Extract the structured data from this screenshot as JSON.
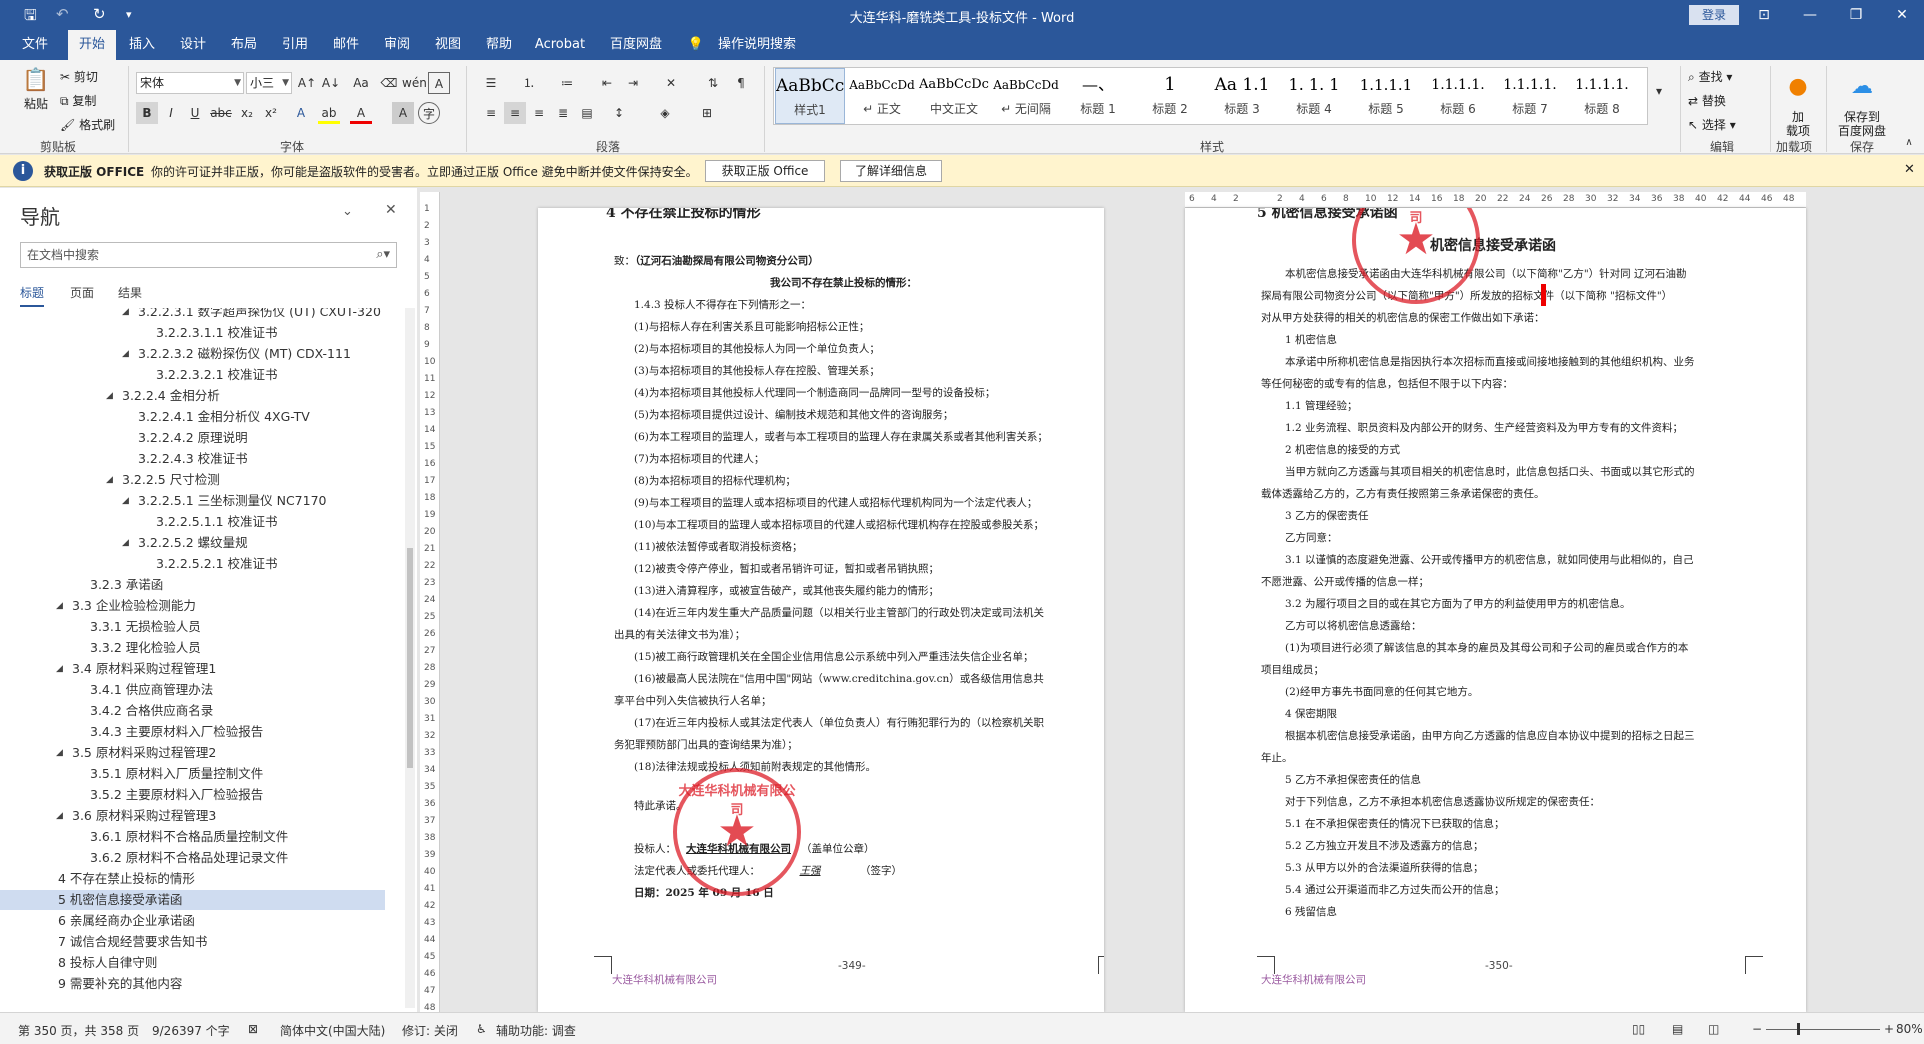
{
  "window": {
    "title": "大连华科-磨铣类工具-投标文件 - Word",
    "login": "登录"
  },
  "tabs": [
    "文件",
    "开始",
    "插入",
    "设计",
    "布局",
    "引用",
    "邮件",
    "审阅",
    "视图",
    "帮助",
    "Acrobat",
    "百度网盘",
    "操作说明搜索"
  ],
  "share": "共享",
  "ribbon": {
    "clipboard": {
      "paste": "粘贴",
      "cut": "剪切",
      "copy": "复制",
      "format_painter": "格式刷",
      "label": "剪贴板"
    },
    "font": {
      "name": "宋体",
      "size": "小三",
      "label": "字体"
    },
    "paragraph": {
      "label": "段落"
    },
    "styles": {
      "label": "样式",
      "items": [
        {
          "preview": "AaBbCc",
          "name": "样式1"
        },
        {
          "preview": "AaBbCcDd",
          "name": "↵ 正文"
        },
        {
          "preview": "AaBbCcDc",
          "name": "中文正文"
        },
        {
          "preview": "AaBbCcDd",
          "name": "↵ 无间隔"
        },
        {
          "preview": "—、",
          "name": "标题 1"
        },
        {
          "preview": "1",
          "name": "标题 2"
        },
        {
          "preview": "Aa 1.1",
          "name": "标题 3"
        },
        {
          "preview": "1. 1. 1",
          "name": "标题 4"
        },
        {
          "preview": "1.1.1.1",
          "name": "标题 5"
        },
        {
          "preview": "1.1.1.1.",
          "name": "标题 6"
        },
        {
          "preview": "1.1.1.1.",
          "name": "标题 7"
        },
        {
          "preview": "1.1.1.1.",
          "name": "标题 8"
        }
      ]
    },
    "editing": {
      "find": "查找",
      "replace": "替换",
      "select": "选择",
      "label": "编辑"
    },
    "addins": {
      "btn": "加\n载项",
      "label": "加载项"
    },
    "save": {
      "btn": "保存到\n百度网盘",
      "label": "保存"
    }
  },
  "message_bar": {
    "title": "获取正版 OFFICE",
    "text": "你的许可证并非正版，你可能是盗版软件的受害者。立即通过正版 Office 避免中断并使文件保持安全。",
    "btn1": "获取正版 Office",
    "btn2": "了解详细信息"
  },
  "nav": {
    "title": "导航",
    "search_placeholder": "在文档中搜索",
    "tabs": [
      "标题",
      "页面",
      "结果"
    ],
    "items": [
      {
        "text": "3.2.2.3.1 数字超声探伤仪 (UT) CXUT-320",
        "level": 5,
        "tri": "expanded"
      },
      {
        "text": "3.2.2.3.1.1 校准证书",
        "level": 6,
        "tri": ""
      },
      {
        "text": "3.2.2.3.2 磁粉探伤仪 (MT) CDX-111",
        "level": 5,
        "tri": "expanded"
      },
      {
        "text": "3.2.2.3.2.1 校准证书",
        "level": 6,
        "tri": ""
      },
      {
        "text": "3.2.2.4 金相分析",
        "level": 4,
        "tri": "expanded"
      },
      {
        "text": "3.2.2.4.1 金相分析仪 4XG-TV",
        "level": 5,
        "tri": ""
      },
      {
        "text": "3.2.2.4.2 原理说明",
        "level": 5,
        "tri": ""
      },
      {
        "text": "3.2.2.4.3 校准证书",
        "level": 5,
        "tri": ""
      },
      {
        "text": "3.2.2.5 尺寸检测",
        "level": 4,
        "tri": "expanded"
      },
      {
        "text": "3.2.2.5.1 三坐标测量仪 NC7170",
        "level": 5,
        "tri": "expanded"
      },
      {
        "text": "3.2.2.5.1.1 校准证书",
        "level": 6,
        "tri": ""
      },
      {
        "text": "3.2.2.5.2 螺纹量规",
        "level": 5,
        "tri": "expanded"
      },
      {
        "text": "3.2.2.5.2.1 校准证书",
        "level": 6,
        "tri": ""
      },
      {
        "text": "3.2.3 承诺函",
        "level": 3,
        "tri": ""
      },
      {
        "text": "3.3 企业检验检测能力",
        "level": 2,
        "tri": "expanded"
      },
      {
        "text": "3.3.1 无损检验人员",
        "level": 3,
        "tri": ""
      },
      {
        "text": "3.3.2 理化检验人员",
        "level": 3,
        "tri": ""
      },
      {
        "text": "3.4 原材料采购过程管理1",
        "level": 2,
        "tri": "expanded"
      },
      {
        "text": "3.4.1 供应商管理办法",
        "level": 3,
        "tri": ""
      },
      {
        "text": "3.4.2 合格供应商名录",
        "level": 3,
        "tri": ""
      },
      {
        "text": "3.4.3 主要原材料入厂检验报告",
        "level": 3,
        "tri": ""
      },
      {
        "text": "3.5 原材料采购过程管理2",
        "level": 2,
        "tri": "expanded"
      },
      {
        "text": "3.5.1 原材料入厂质量控制文件",
        "level": 3,
        "tri": ""
      },
      {
        "text": "3.5.2 主要原材料入厂检验报告",
        "level": 3,
        "tri": ""
      },
      {
        "text": "3.6 原材料采购过程管理3",
        "level": 2,
        "tri": "expanded"
      },
      {
        "text": "3.6.1 原材料不合格品质量控制文件",
        "level": 3,
        "tri": ""
      },
      {
        "text": "3.6.2 原材料不合格品处理记录文件",
        "level": 3,
        "tri": ""
      },
      {
        "text": "4 不存在禁止投标的情形",
        "level": 1,
        "tri": ""
      },
      {
        "text": "5 机密信息接受承诺函",
        "level": 1,
        "tri": "",
        "selected": true
      },
      {
        "text": "6 亲属经商办企业承诺函",
        "level": 1,
        "tri": ""
      },
      {
        "text": "7 诚信合规经营要求告知书",
        "level": 1,
        "tri": ""
      },
      {
        "text": "8 投标人自律守则",
        "level": 1,
        "tri": ""
      },
      {
        "text": "9 需要补充的其他内容",
        "level": 1,
        "tri": ""
      }
    ]
  },
  "page_left": {
    "heading_partial": "4 不存在禁止投标的情形",
    "to_prefix": "致：",
    "to_company": "（辽河石油勘探局有限公司物资分公司）",
    "subtitle": "我公司不存在禁止投标的情形：",
    "lines": [
      "1.4.3 投标人不得存在下列情形之一：",
      "(1)与招标人存在利害关系且可能影响招标公正性；",
      "(2)与本招标项目的其他投标人为同一个单位负责人；",
      "(3)与本招标项目的其他投标人存在控股、管理关系；",
      "(4)为本招标项目其他投标人代理同一个制造商同一品牌同一型号的设备投标；",
      "(5)为本招标项目提供过设计、编制技术规范和其他文件的咨询服务；",
      "(6)为本工程项目的监理人，或者与本工程项目的监理人存在隶属关系或者其他利害关系；",
      "(7)为本招标项目的代建人；",
      "(8)为本招标项目的招标代理机构；",
      "(9)与本工程项目的监理人或本招标项目的代建人或招标代理机构同为一个法定代表人；",
      "(10)与本工程项目的监理人或本招标项目的代建人或招标代理机构存在控股或参股关系；",
      "(11)被依法暂停或者取消投标资格；",
      "(12)被责令停产停业，暂扣或者吊销许可证，暂扣或者吊销执照；",
      "(13)进入清算程序，或被宣告破产，或其他丧失履约能力的情形；",
      "(14)在近三年内发生重大产品质量问题（以相关行业主管部门的行政处罚决定或司法机关",
      "出具的有关法律文书为准）；",
      "(15)被工商行政管理机关在全国企业信用信息公示系统中列入严重违法失信企业名单；",
      "(16)被最高人民法院在\"信用中国\"网站（www.creditchina.gov.cn）或各级信用信息共",
      "享平台中列入失信被执行人名单；",
      "(17)在近三年内投标人或其法定代表人（单位负责人）有行贿犯罪行为的（以检察机关职",
      "务犯罪预防部门出具的查询结果为准）；",
      "(18)法律法规或投标人须知前附表规定的其他情形。"
    ],
    "closing": "特此承诺。",
    "bidder_label": "投标人：",
    "bidder_name": "大连华科机械有限公司",
    "bidder_suffix": "（盖单位公章）",
    "rep_label": "法定代表人或委托代理人：",
    "rep_sign": "王强",
    "rep_suffix": "（签字）",
    "date": "日期：2025 年 09 月 16 日",
    "page_number": "-349-",
    "footer_company": "大连华科机械有限公司",
    "seal_text": "大连华科机械有限公司"
  },
  "page_right": {
    "heading_partial": "5 机密信息接受承诺函",
    "title": "机密信息接受承诺函",
    "lines": [
      "本机密信息接受承诺函由大连华科机械有限公司（以下简称\"乙方\"）针对同 辽河石油勘",
      "探局有限公司物资分公司（以下简称\"甲方\"）所发放的招标文件（以下简称 \"招标文件\"）",
      "对从甲方处获得的相关的机密信息的保密工作做出如下承诺：",
      "1 机密信息",
      "本承诺中所称机密信息是指因执行本次招标而直接或间接地接触到的其他组织机构、业务",
      "等任何秘密的或专有的信息，包括但不限于以下内容：",
      "1.1 管理经验；",
      "1.2 业务流程、职员资料及内部公开的财务、生产经营资料及为甲方专有的文件资料；",
      "2 机密信息的接受的方式",
      "当甲方就向乙方透露与其项目相关的机密信息时，此信息包括口头、书面或以其它形式的",
      "载体透露给乙方的，乙方有责任按照第三条承诺保密的责任。",
      "3 乙方的保密责任",
      "乙方同意：",
      "3.1 以谨慎的态度避免泄露、公开或传播甲方的机密信息，就如同使用与此相似的，自己",
      "不愿泄露、公开或传播的信息一样；",
      "3.2 为履行项目之目的或在其它方面为了甲方的利益使用甲方的机密信息。",
      "乙方可以将机密信息透露给：",
      "(1)为项目进行必须了解该信息的其本身的雇员及其母公司和子公司的雇员或合作方的本",
      "项目组成员；",
      "(2)经甲方事先书面同意的任何其它地方。",
      "4 保密期限",
      "根据本机密信息接受承诺函，由甲方向乙方透露的信息应自本协议中提到的招标之日起三",
      "年止。",
      "5 乙方不承担保密责任的信息",
      "对于下列信息，乙方不承担本机密信息透露协议所规定的保密责任：",
      "5.1 在不承担保密责任的情况下已获取的信息；",
      "5.2 乙方独立开发且不涉及透露方的信息；",
      "5.3 从甲方以外的合法渠道所获得的信息；",
      "5.4 通过公开渠道而非乙方过失而公开的信息；",
      "6 残留信息"
    ],
    "page_number": "-350-",
    "footer_company": "大连华科机械有限公司",
    "seal_text": "大连华科机械有限公司"
  },
  "vruler_ticks": [
    "1",
    "2",
    "3",
    "4",
    "5",
    "6",
    "7",
    "8",
    "9",
    "10",
    "11",
    "12",
    "13",
    "14",
    "15",
    "16",
    "17",
    "18",
    "19",
    "20",
    "21",
    "22",
    "23",
    "24",
    "25",
    "26",
    "27",
    "28",
    "29",
    "30",
    "31",
    "32",
    "33",
    "34",
    "35",
    "36",
    "37",
    "38",
    "39",
    "40",
    "41",
    "42",
    "43",
    "44",
    "45",
    "46",
    "47",
    "48"
  ],
  "hruler_ticks": [
    "6",
    "4",
    "2",
    "",
    "2",
    "4",
    "6",
    "8",
    "10",
    "12",
    "14",
    "16",
    "18",
    "20",
    "22",
    "24",
    "26",
    "28",
    "30",
    "32",
    "34",
    "36",
    "38",
    "40",
    "42",
    "44",
    "46",
    "48"
  ],
  "status": {
    "page": "第 350 页，共 358 页",
    "words": "9/26397 个字",
    "lang": "简体中文(中国大陆)",
    "track": "修订: 关闭",
    "access": "辅助功能: 调查",
    "zoom": "80%"
  },
  "colors": {
    "accent": "#2b579a",
    "seal": "#dc1e28",
    "message_bar": "#fff4ce"
  }
}
